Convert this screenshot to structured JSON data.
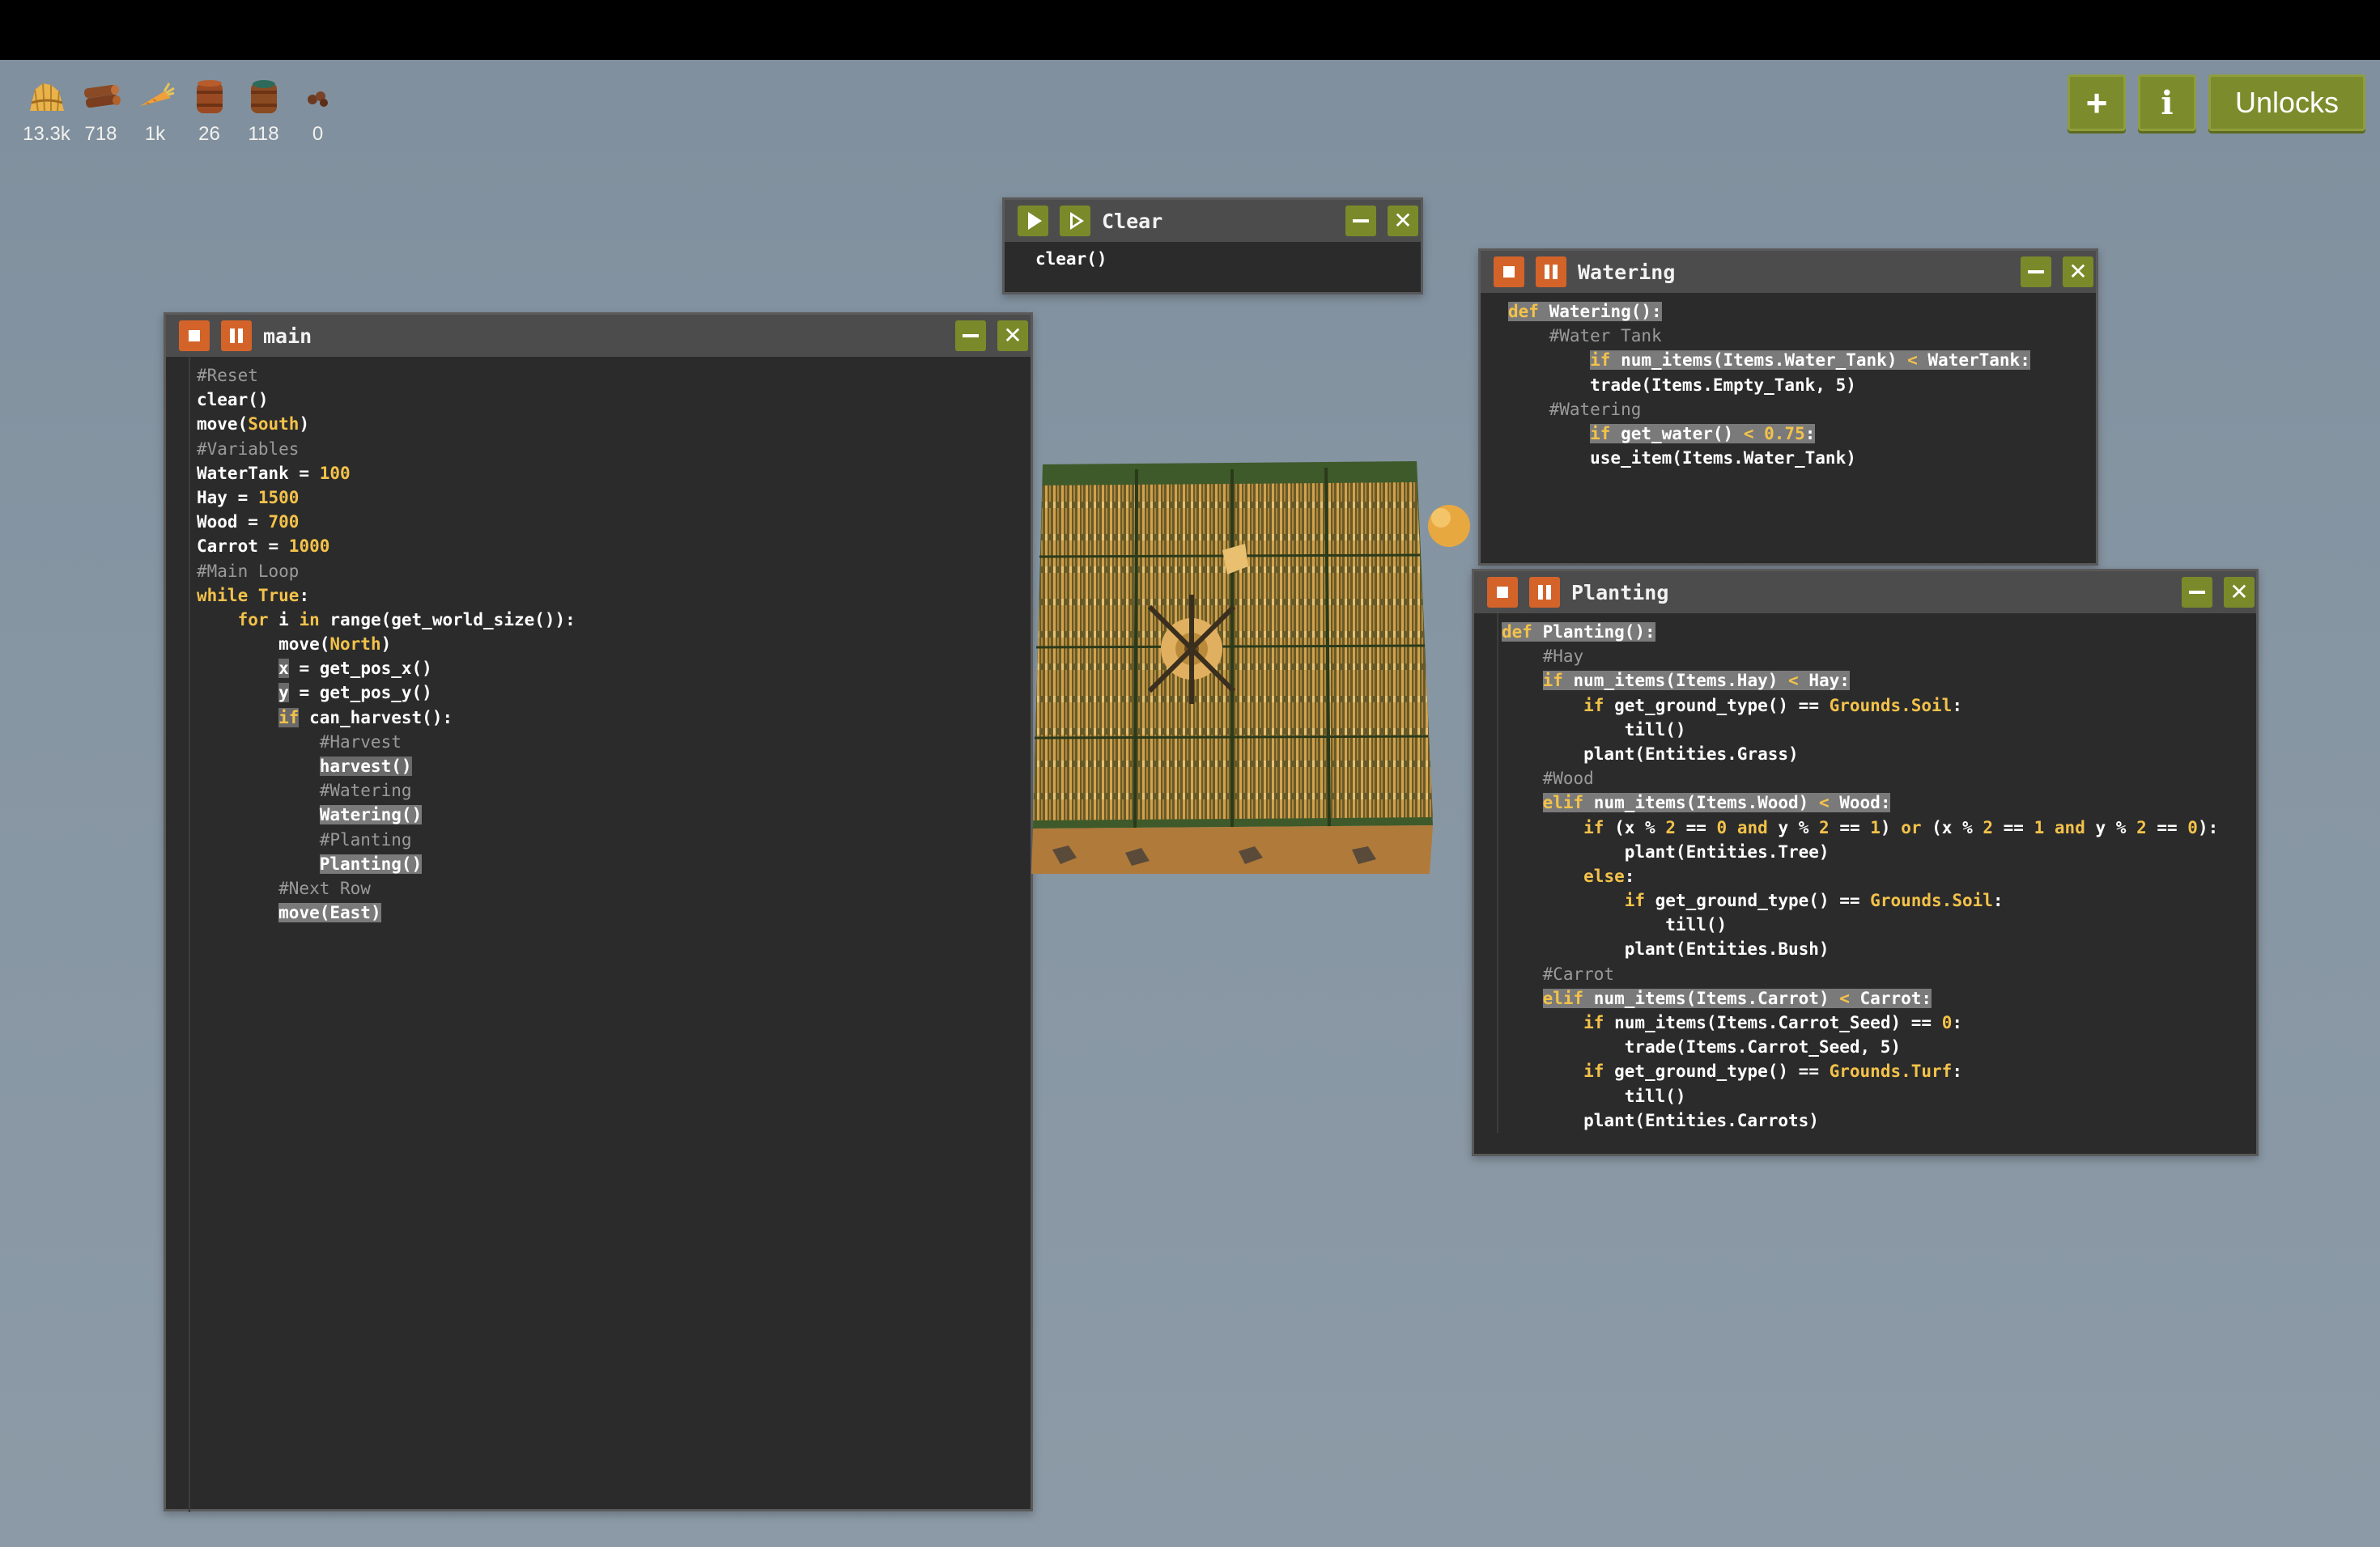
{
  "resources": [
    {
      "icon": "hay-icon",
      "count": "13.3k"
    },
    {
      "icon": "wood-icon",
      "count": "718"
    },
    {
      "icon": "carrot-icon",
      "count": "1k"
    },
    {
      "icon": "empty-tank-icon",
      "count": "26"
    },
    {
      "icon": "water-tank-icon",
      "count": "118"
    },
    {
      "icon": "seed-icon",
      "count": "0"
    }
  ],
  "toolbar": {
    "plus_label": "+",
    "info_label": "i",
    "unlocks_label": "Unlocks"
  },
  "windows": {
    "clear": {
      "title": "Clear",
      "lines": [
        "clear()"
      ]
    },
    "watering": {
      "title": "Watering",
      "lines": [
        "def Watering():",
        "    #Water Tank",
        "    if num_items(Items.Water_Tank) < WaterTank:",
        "        trade(Items.Empty_Tank, 5)",
        "    #Watering",
        "    if get_water() < 0.75:",
        "        use_item(Items.Water_Tank)"
      ]
    },
    "main": {
      "title": "main",
      "lines": [
        "#Reset",
        "clear()",
        "move(South)",
        "#Variables",
        "WaterTank = 100",
        "Hay = 1500",
        "Wood = 700",
        "Carrot = 1000",
        "#Main Loop",
        "while True:",
        "    for i in range(get_world_size()):",
        "        move(North)",
        "        x = get_pos_x()",
        "        y = get_pos_y()",
        "        if can_harvest():",
        "            #Harvest",
        "            harvest()",
        "            #Watering",
        "            Watering()",
        "            #Planting",
        "            Planting()",
        "        #Next Row",
        "        move(East)"
      ]
    },
    "planting": {
      "title": "Planting",
      "lines": [
        "def Planting():",
        "    #Hay",
        "    if num_items(Items.Hay) < Hay:",
        "        if get_ground_type() == Grounds.Soil:",
        "            till()",
        "        plant(Entities.Grass)",
        "    #Wood",
        "    elif num_items(Items.Wood) < Wood:",
        "        if (x % 2 == 0 and y % 2 == 1) or (x % 2 == 1 and y % 2 == 0):",
        "            plant(Entities.Tree)",
        "        else:",
        "            if get_ground_type() == Grounds.Soil:",
        "                till()",
        "            plant(Entities.Bush)",
        "    #Carrot",
        "    elif num_items(Items.Carrot) < Carrot:",
        "        if num_items(Items.Carrot_Seed) == 0:",
        "            trade(Items.Carrot_Seed, 5)",
        "        if get_ground_type() == Grounds.Turf:",
        "            till()",
        "        plant(Entities.Carrots)"
      ]
    }
  },
  "colors": {
    "accent_green": "#7a8a2a",
    "stop_orange": "#d4632a",
    "keyword": "#f3c24a",
    "comment": "#9a9a9a"
  }
}
